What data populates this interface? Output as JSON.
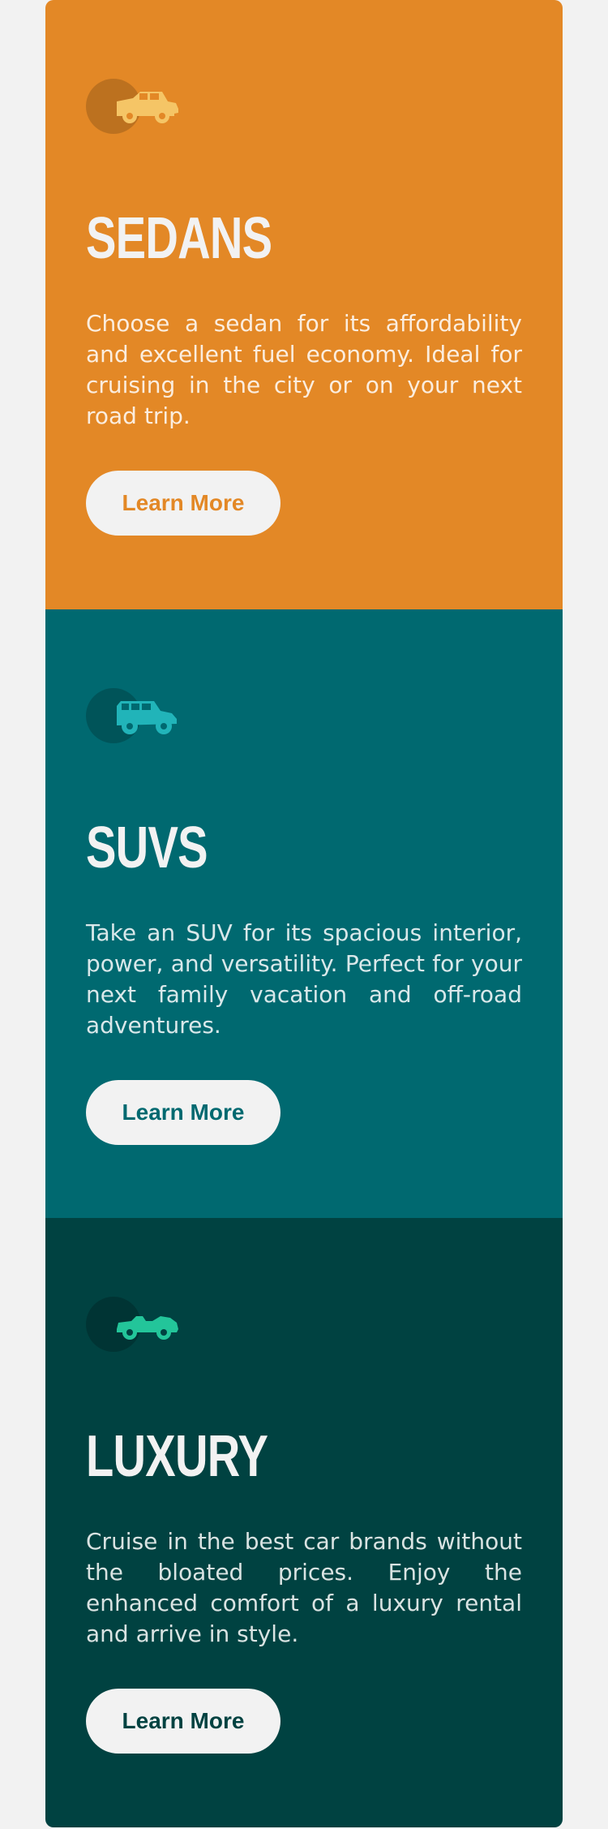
{
  "cards": [
    {
      "title": "SEDANS",
      "description": "Choose a sedan for its affordability and excellent fuel economy. Ideal for cruising in the city or on your next road trip.",
      "button_label": "Learn More",
      "icon": "sedan-icon",
      "background": "#e38826",
      "accent": "#e38826",
      "icon_color": "#f5c566"
    },
    {
      "title": "SUVS",
      "description": "Take an SUV for its spacious interior, power, and versatility. Perfect for your next family vacation and off-road adventures.",
      "button_label": "Learn More",
      "icon": "suv-icon",
      "background": "#006970",
      "accent": "#006970",
      "icon_color": "#21b4b9"
    },
    {
      "title": "LUXURY",
      "description": "Cruise in the best car brands without the bloated prices. Enjoy the enhanced comfort of a luxury rental and arrive in style.",
      "button_label": "Learn More",
      "icon": "luxury-car-icon",
      "background": "#004241",
      "accent": "#004241",
      "icon_color": "#23c59a"
    }
  ]
}
